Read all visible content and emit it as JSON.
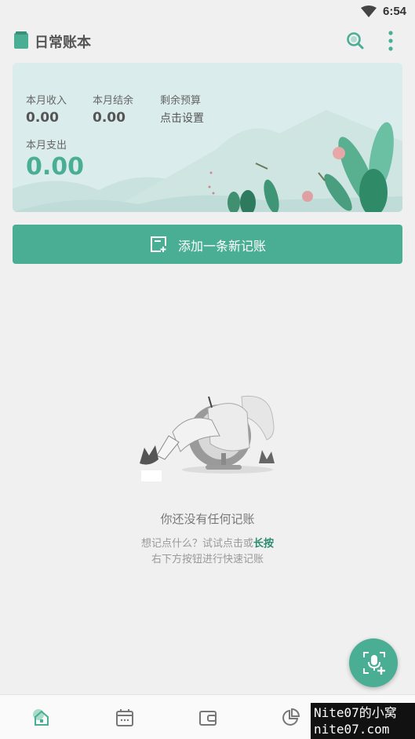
{
  "status_bar": {
    "time": "6:54",
    "wifi_icon": "wifi-icon"
  },
  "app_bar": {
    "title": "日常账本",
    "logo_icon": "book-icon",
    "search_icon": "search-icon",
    "more_icon": "more-vertical-icon"
  },
  "summary": {
    "income_label": "本月收入",
    "income_value": "0.00",
    "balance_label": "本月结余",
    "balance_value": "0.00",
    "budget_label": "剩余预算",
    "budget_action": "点击设置",
    "expense_label": "本月支出",
    "expense_value": "0.00"
  },
  "add_record": {
    "label": "添加一条新记账",
    "icon": "add-note-icon"
  },
  "empty_state": {
    "title": "你还没有任何记账",
    "hint_prefix": "想记点什么？试试点击或",
    "hint_highlight": "长按",
    "hint_suffix": "右下方按钮进行快速记账"
  },
  "fab": {
    "icon": "voice-add-icon"
  },
  "bottom_nav": {
    "items": [
      "home-icon",
      "calendar-icon",
      "wallet-icon",
      "pie-chart-icon"
    ]
  },
  "watermark": {
    "line1": "Nite07的小窝",
    "line2": "nite07.com"
  },
  "colors": {
    "accent": "#4aae94",
    "card_bg": "#dbecec",
    "page_bg": "#f0f0f0"
  }
}
